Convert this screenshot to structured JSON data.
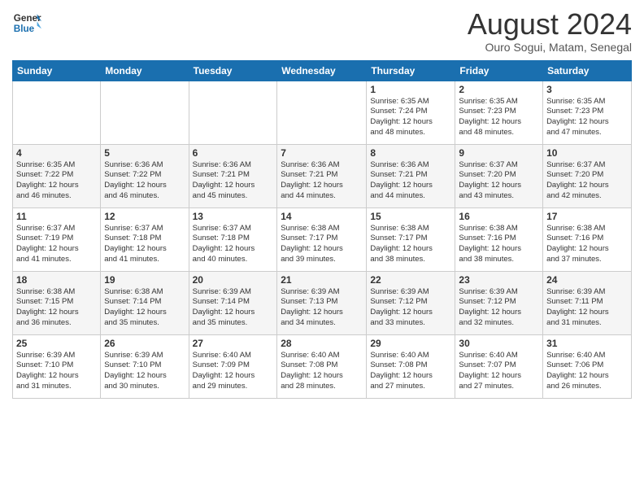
{
  "header": {
    "logo_line1": "General",
    "logo_line2": "Blue",
    "month_title": "August 2024",
    "subtitle": "Ouro Sogui, Matam, Senegal"
  },
  "weekdays": [
    "Sunday",
    "Monday",
    "Tuesday",
    "Wednesday",
    "Thursday",
    "Friday",
    "Saturday"
  ],
  "weeks": [
    [
      {
        "day": "",
        "info": ""
      },
      {
        "day": "",
        "info": ""
      },
      {
        "day": "",
        "info": ""
      },
      {
        "day": "",
        "info": ""
      },
      {
        "day": "1",
        "info": "Sunrise: 6:35 AM\nSunset: 7:24 PM\nDaylight: 12 hours\nand 48 minutes."
      },
      {
        "day": "2",
        "info": "Sunrise: 6:35 AM\nSunset: 7:23 PM\nDaylight: 12 hours\nand 48 minutes."
      },
      {
        "day": "3",
        "info": "Sunrise: 6:35 AM\nSunset: 7:23 PM\nDaylight: 12 hours\nand 47 minutes."
      }
    ],
    [
      {
        "day": "4",
        "info": "Sunrise: 6:35 AM\nSunset: 7:22 PM\nDaylight: 12 hours\nand 46 minutes."
      },
      {
        "day": "5",
        "info": "Sunrise: 6:36 AM\nSunset: 7:22 PM\nDaylight: 12 hours\nand 46 minutes."
      },
      {
        "day": "6",
        "info": "Sunrise: 6:36 AM\nSunset: 7:21 PM\nDaylight: 12 hours\nand 45 minutes."
      },
      {
        "day": "7",
        "info": "Sunrise: 6:36 AM\nSunset: 7:21 PM\nDaylight: 12 hours\nand 44 minutes."
      },
      {
        "day": "8",
        "info": "Sunrise: 6:36 AM\nSunset: 7:21 PM\nDaylight: 12 hours\nand 44 minutes."
      },
      {
        "day": "9",
        "info": "Sunrise: 6:37 AM\nSunset: 7:20 PM\nDaylight: 12 hours\nand 43 minutes."
      },
      {
        "day": "10",
        "info": "Sunrise: 6:37 AM\nSunset: 7:20 PM\nDaylight: 12 hours\nand 42 minutes."
      }
    ],
    [
      {
        "day": "11",
        "info": "Sunrise: 6:37 AM\nSunset: 7:19 PM\nDaylight: 12 hours\nand 41 minutes."
      },
      {
        "day": "12",
        "info": "Sunrise: 6:37 AM\nSunset: 7:18 PM\nDaylight: 12 hours\nand 41 minutes."
      },
      {
        "day": "13",
        "info": "Sunrise: 6:37 AM\nSunset: 7:18 PM\nDaylight: 12 hours\nand 40 minutes."
      },
      {
        "day": "14",
        "info": "Sunrise: 6:38 AM\nSunset: 7:17 PM\nDaylight: 12 hours\nand 39 minutes."
      },
      {
        "day": "15",
        "info": "Sunrise: 6:38 AM\nSunset: 7:17 PM\nDaylight: 12 hours\nand 38 minutes."
      },
      {
        "day": "16",
        "info": "Sunrise: 6:38 AM\nSunset: 7:16 PM\nDaylight: 12 hours\nand 38 minutes."
      },
      {
        "day": "17",
        "info": "Sunrise: 6:38 AM\nSunset: 7:16 PM\nDaylight: 12 hours\nand 37 minutes."
      }
    ],
    [
      {
        "day": "18",
        "info": "Sunrise: 6:38 AM\nSunset: 7:15 PM\nDaylight: 12 hours\nand 36 minutes."
      },
      {
        "day": "19",
        "info": "Sunrise: 6:38 AM\nSunset: 7:14 PM\nDaylight: 12 hours\nand 35 minutes."
      },
      {
        "day": "20",
        "info": "Sunrise: 6:39 AM\nSunset: 7:14 PM\nDaylight: 12 hours\nand 35 minutes."
      },
      {
        "day": "21",
        "info": "Sunrise: 6:39 AM\nSunset: 7:13 PM\nDaylight: 12 hours\nand 34 minutes."
      },
      {
        "day": "22",
        "info": "Sunrise: 6:39 AM\nSunset: 7:12 PM\nDaylight: 12 hours\nand 33 minutes."
      },
      {
        "day": "23",
        "info": "Sunrise: 6:39 AM\nSunset: 7:12 PM\nDaylight: 12 hours\nand 32 minutes."
      },
      {
        "day": "24",
        "info": "Sunrise: 6:39 AM\nSunset: 7:11 PM\nDaylight: 12 hours\nand 31 minutes."
      }
    ],
    [
      {
        "day": "25",
        "info": "Sunrise: 6:39 AM\nSunset: 7:10 PM\nDaylight: 12 hours\nand 31 minutes."
      },
      {
        "day": "26",
        "info": "Sunrise: 6:39 AM\nSunset: 7:10 PM\nDaylight: 12 hours\nand 30 minutes."
      },
      {
        "day": "27",
        "info": "Sunrise: 6:40 AM\nSunset: 7:09 PM\nDaylight: 12 hours\nand 29 minutes."
      },
      {
        "day": "28",
        "info": "Sunrise: 6:40 AM\nSunset: 7:08 PM\nDaylight: 12 hours\nand 28 minutes."
      },
      {
        "day": "29",
        "info": "Sunrise: 6:40 AM\nSunset: 7:08 PM\nDaylight: 12 hours\nand 27 minutes."
      },
      {
        "day": "30",
        "info": "Sunrise: 6:40 AM\nSunset: 7:07 PM\nDaylight: 12 hours\nand 27 minutes."
      },
      {
        "day": "31",
        "info": "Sunrise: 6:40 AM\nSunset: 7:06 PM\nDaylight: 12 hours\nand 26 minutes."
      }
    ]
  ]
}
